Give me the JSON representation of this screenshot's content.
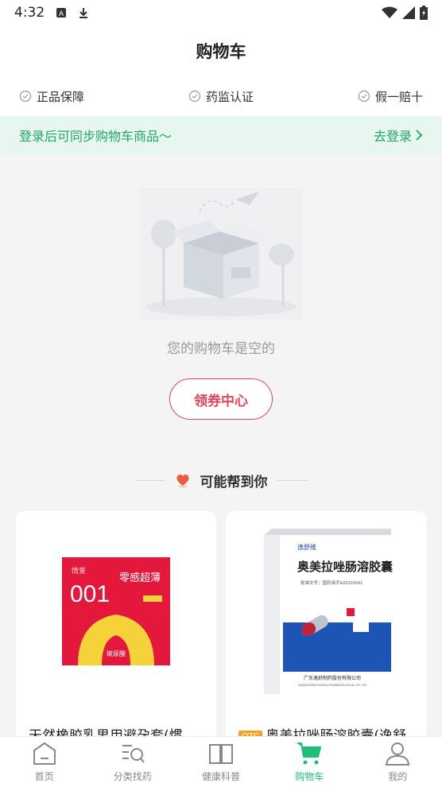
{
  "status_bar": {
    "time": "4:32"
  },
  "header": {
    "title": "购物车"
  },
  "guarantees": [
    {
      "label": "正品保障"
    },
    {
      "label": "药监认证"
    },
    {
      "label": "假一赔十"
    }
  ],
  "login_bar": {
    "message": "登录后可同步购物车商品～",
    "action": "去登录"
  },
  "empty_state": {
    "text": "您的购物车是空的",
    "coupon_button": "领券中心"
  },
  "recommend": {
    "title": "可能帮到你"
  },
  "products": [
    {
      "name": "天然橡胶乳男用避孕套(惯",
      "otc": false,
      "brand": "情爱",
      "big_text": "001",
      "headline": "零感超薄",
      "badge": "玻尿酸"
    },
    {
      "name": "奥美拉唑肠溶胶囊(逸舒",
      "otc": true,
      "otc_label": "OTC",
      "brand": "逸舒维",
      "headline": "奥美拉唑肠溶胶囊",
      "approval": "批准文号：国药准字H20103041",
      "company": "广东逸舒制药股份有限公司",
      "company_en": "GUANGDONG EASHU PHARMACEUTICAL CO.,LTD"
    }
  ],
  "tabs": [
    {
      "label": "首页",
      "icon": "home-icon"
    },
    {
      "label": "分类找药",
      "icon": "category-search-icon"
    },
    {
      "label": "健康科普",
      "icon": "book-icon"
    },
    {
      "label": "购物车",
      "icon": "cart-icon",
      "active": true
    },
    {
      "label": "我的",
      "icon": "user-icon"
    }
  ],
  "colors": {
    "accent_green": "#1fbe77",
    "login_green": "#1fa866",
    "coupon_red": "#e8435a",
    "otc_orange": "#f3a21b"
  }
}
